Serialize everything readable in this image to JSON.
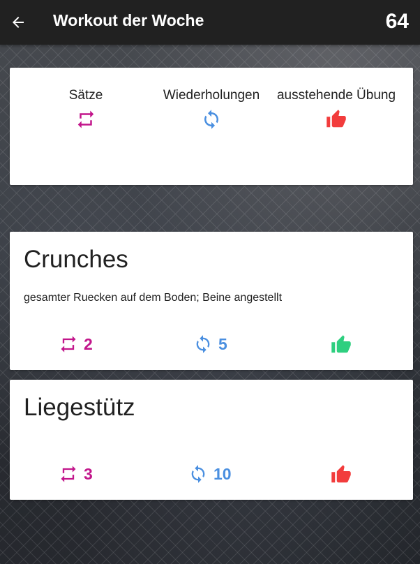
{
  "appbar": {
    "title": "Workout der Woche",
    "counter": "64"
  },
  "legend": {
    "sets_label": "Sätze",
    "reps_label": "Wiederholungen",
    "pending_label": "ausstehende Übung"
  },
  "exercises": [
    {
      "name": "Crunches",
      "description": "gesamter Ruecken auf dem Boden; Beine angestellt",
      "sets": "2",
      "reps": "5",
      "status": "done",
      "status_icon": "thumbs-up-icon",
      "status_color": "#2ecf7f"
    },
    {
      "name": "Liegestütz",
      "description": "",
      "sets": "3",
      "reps": "10",
      "status": "pending",
      "status_icon": "thumbs-up-icon",
      "status_color": "#f23c3c"
    }
  ],
  "colors": {
    "appbar": "#212121",
    "sets": "#c2168b",
    "reps": "#4a8fe0",
    "pending": "#f23c3c",
    "done": "#2ecf7f"
  }
}
